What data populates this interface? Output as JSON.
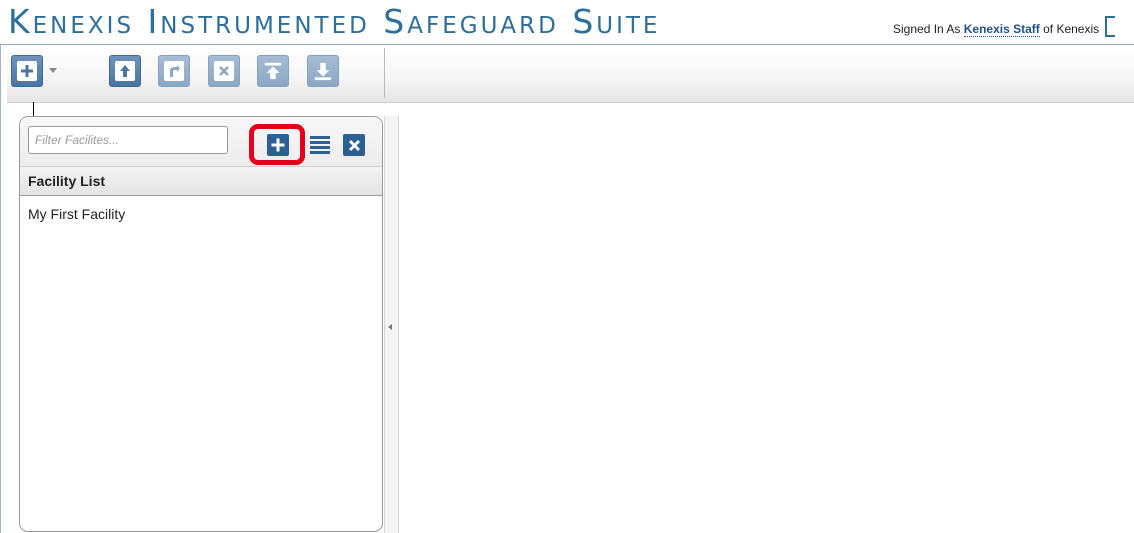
{
  "app": {
    "title": "Kenexis Instrumented Safeguard Suite",
    "signed_in_prefix": "Signed In As",
    "user_name": "Kenexis Staff",
    "org_text": "of Kenexis"
  },
  "toolbar": {
    "buttons": [
      {
        "icon": "add-icon"
      },
      {
        "icon": "dropdown-arrow-icon"
      },
      {
        "icon": "upload-icon"
      },
      {
        "icon": "edit-icon"
      },
      {
        "icon": "delete-icon"
      },
      {
        "icon": "import-icon"
      },
      {
        "icon": "download-icon"
      }
    ]
  },
  "facility_panel": {
    "filter_placeholder": "Filter Facilites...",
    "filter_value": "",
    "list_header": "Facility List",
    "items": [
      "My First Facility"
    ]
  },
  "colors": {
    "accent": "#2e6e9a",
    "icon_blue": "#2c6092",
    "highlight": "#e4001c"
  }
}
